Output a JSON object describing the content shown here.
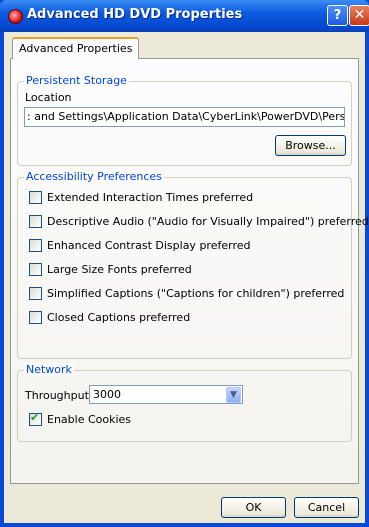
{
  "window": {
    "title": "Advanced HD DVD Properties",
    "help_label": "?",
    "close_label": "✕"
  },
  "tabs": [
    {
      "label": "Advanced Properties"
    }
  ],
  "persistent_storage": {
    "group_label": "Persistent Storage",
    "location_label": "Location",
    "location_value": ": and Settings\\Application Data\\CyberLink\\PowerDVD\\Persistent\\",
    "browse_label": "Browse..."
  },
  "accessibility": {
    "group_label": "Accessibility Preferences",
    "options": [
      {
        "label": "Extended Interaction Times preferred",
        "checked": false
      },
      {
        "label": "Descriptive Audio (\"Audio for Visually Impaired\") preferred",
        "checked": false
      },
      {
        "label": "Enhanced Contrast Display preferred",
        "checked": false
      },
      {
        "label": "Large Size Fonts preferred",
        "checked": false
      },
      {
        "label": "Simplified Captions (\"Captions for children\") preferred",
        "checked": false
      },
      {
        "label": "Closed Captions preferred",
        "checked": false
      }
    ]
  },
  "network": {
    "group_label": "Network",
    "throughput_label": "Throughput",
    "throughput_value": "3000",
    "enable_cookies_label": "Enable Cookies",
    "enable_cookies_checked": true
  },
  "footer": {
    "ok_label": "OK",
    "cancel_label": "Cancel"
  },
  "colors": {
    "titlebar": "#0a5be0",
    "group_label": "#0046d5"
  }
}
